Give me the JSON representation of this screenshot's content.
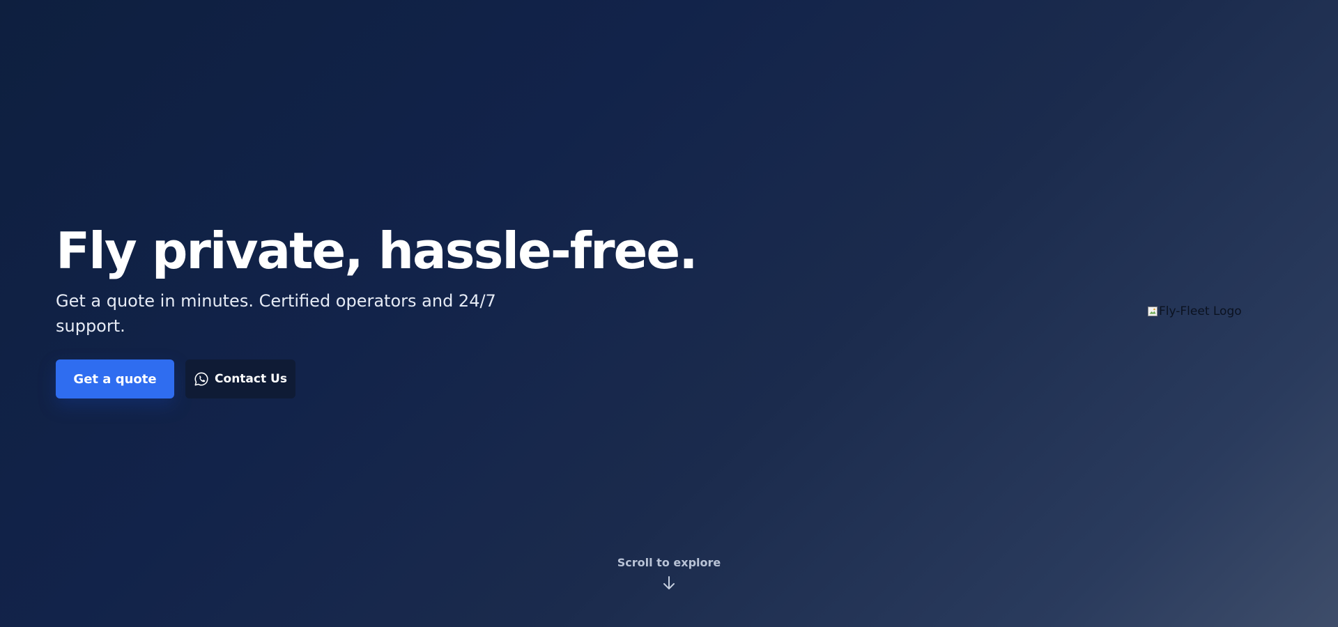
{
  "hero": {
    "headline": "Fly private, hassle-free.",
    "subheadline": "Get a quote in minutes. Certified operators and 24/7 support.",
    "primary_cta": "Get a quote",
    "secondary_cta": "Contact Us",
    "secondary_cta_icon": "whatsapp-icon"
  },
  "logo": {
    "alt_text": "Fly-Fleet Logo"
  },
  "scroll": {
    "label": "Scroll to explore",
    "icon": "arrow-down-icon"
  },
  "colors": {
    "background_start": "#0e1f3f",
    "background_end": "#3e4d6a",
    "accent": "#2f6df0",
    "secondary_button": "#0f1b35"
  }
}
